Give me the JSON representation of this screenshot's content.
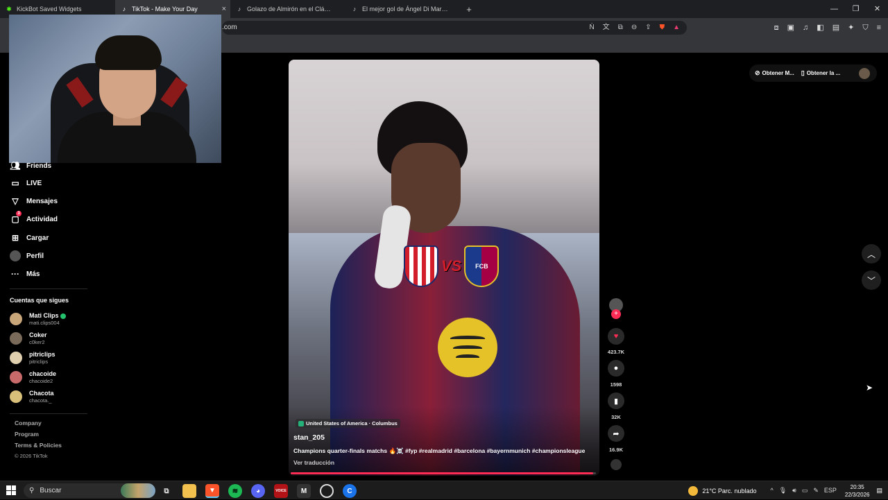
{
  "browser": {
    "tabs": [
      {
        "title": "KickBot Saved Widgets",
        "active": false
      },
      {
        "title": "TikTok - Make Your Day",
        "active": true
      },
      {
        "title": "Golazo de Almirón en el Clásico del S",
        "active": false
      },
      {
        "title": "El mejor gol de Ángel Di María en Qa",
        "active": false
      }
    ],
    "new_tab": "+",
    "url": ".com"
  },
  "sidebar": {
    "nav": [
      {
        "label": "Friends",
        "icon": "friends-icon"
      },
      {
        "label": "LIVE",
        "icon": "live-icon"
      },
      {
        "label": "Mensajes",
        "icon": "messages-icon"
      },
      {
        "label": "Actividad",
        "icon": "activity-icon",
        "badge": "3"
      },
      {
        "label": "Cargar",
        "icon": "upload-icon"
      },
      {
        "label": "Perfil",
        "icon": "profile-icon"
      },
      {
        "label": "Más",
        "icon": "more-icon"
      }
    ],
    "following_title": "Cuentas que sigues",
    "following": [
      {
        "name": "Mati Clips",
        "handle": "mati.clips004",
        "verified": true
      },
      {
        "name": "Coker",
        "handle": "c0ker2",
        "verified": false
      },
      {
        "name": "pitriclips",
        "handle": "pitriclips",
        "verified": false
      },
      {
        "name": "chacoide",
        "handle": "chacoide2",
        "verified": false
      },
      {
        "name": "Chacota",
        "handle": "chacota._",
        "verified": false
      }
    ],
    "footer": [
      "Company",
      "Program",
      "Terms & Policies",
      "© 2026 TikTok"
    ]
  },
  "video": {
    "vs_text": "VS",
    "crest_left": "",
    "crest_right": "FCB",
    "location": "United States of America · Columbus",
    "author": "stan_205",
    "caption": "Champions quarter-finals matchs 🔥☠️ #fyp #realmadrid #barcelona #bayernmunich #championsleague",
    "translate": "Ver traducción",
    "progress": 0.99
  },
  "actions": {
    "likes": "423.7K",
    "comments": "1598",
    "saves": "32K",
    "shares": "16.9K"
  },
  "top_right": {
    "item1": "Obtener M...",
    "item2": "Obtener la ..."
  },
  "taskbar": {
    "search_label": "Buscar",
    "weather": "21°C  Parc. nublado",
    "lang": "ESP",
    "time": "20:35",
    "date": "22/3/2026"
  },
  "colors": {
    "accent": "#fe2c55",
    "verified": "#20d5ec"
  }
}
